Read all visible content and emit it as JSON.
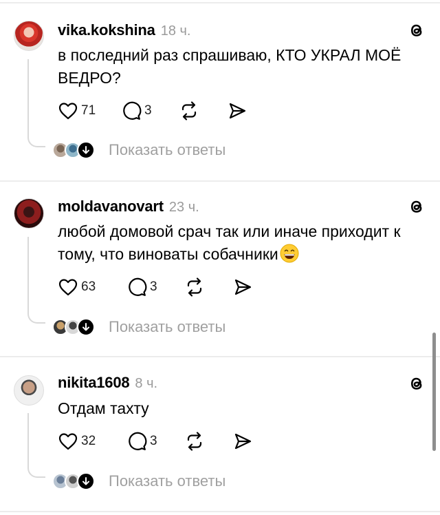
{
  "posts": [
    {
      "username": "vika.kokshina",
      "time": "18 ч.",
      "text": "в последний раз спрашиваю, КТО УКРАЛ МОЁ ВЕДРО?",
      "likes": "71",
      "comments": "3",
      "show_replies": "Показать ответы"
    },
    {
      "username": "moldavanovart",
      "time": "23 ч.",
      "text": "любой домовой срач так или иначе приходит к тому, что виноваты собачники",
      "emoji": "grinning-face-emoji",
      "likes": "63",
      "comments": "3",
      "show_replies": "Показать ответы"
    },
    {
      "username": "nikita1608",
      "time": "8 ч.",
      "text": "Отдам тахту",
      "likes": "32",
      "comments": "3",
      "show_replies": "Показать ответы"
    }
  ],
  "icons": {
    "like": "heart-icon",
    "comment": "comment-icon",
    "repost": "repost-icon",
    "share": "send-icon",
    "brand": "threads-logo-icon",
    "replies": "arrow-down-icon"
  }
}
